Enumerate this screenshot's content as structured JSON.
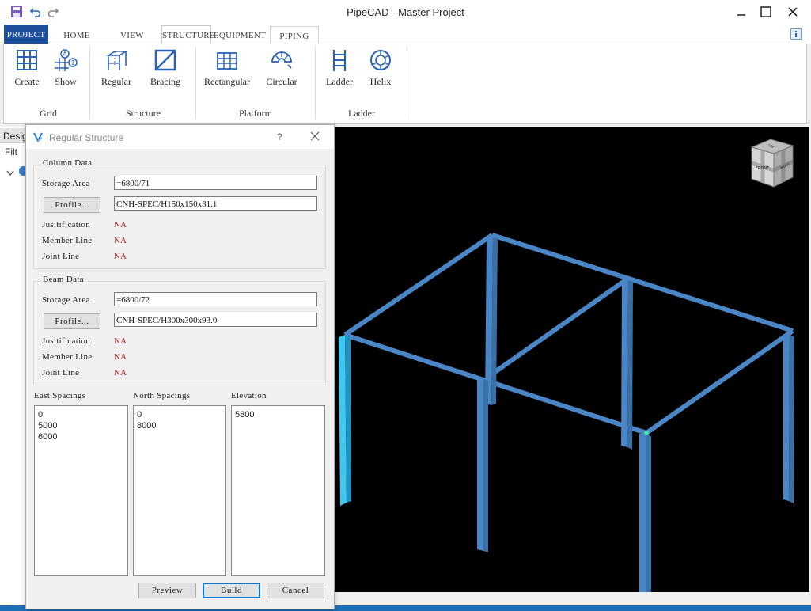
{
  "window": {
    "title": "PipeCAD - Master Project"
  },
  "icons": {
    "save": "save-icon",
    "undo": "undo-icon",
    "redo": "redo-icon",
    "minimize": "minimize-icon",
    "maximize": "maximize-icon",
    "close": "close-icon",
    "info": "info-icon"
  },
  "tabs": [
    {
      "label": "PROJECT"
    },
    {
      "label": "HOME"
    },
    {
      "label": "VIEW"
    },
    {
      "label": "STRUCTURE"
    },
    {
      "label": "EQUIPMENT"
    },
    {
      "label": "PIPING"
    }
  ],
  "ribbon": {
    "buttons": {
      "create": "Create",
      "show": "Show",
      "regular": "Regular",
      "bracing": "Bracing",
      "rectangular": "Rectangular",
      "circular": "Circular",
      "ladder": "Ladder",
      "helix": "Helix"
    },
    "groups": {
      "grid": "Grid",
      "structure": "Structure",
      "platform": "Platform",
      "ladder": "Ladder"
    }
  },
  "leftpanel": {
    "tab_label": "Desig",
    "filter_label": "Filt"
  },
  "dialog": {
    "title": "Regular Structure",
    "help": "?",
    "column": {
      "group_title": "Column Data",
      "storage_label": "Storage Area",
      "storage_value": "=6800/71",
      "profile_button": "Profile...",
      "profile_value": "CNH-SPEC/H150x150x31.1",
      "justification_label": "Jusitification",
      "justification_value": "NA",
      "member_label": "Member Line",
      "member_value": "NA",
      "joint_label": "Joint Line",
      "joint_value": "NA"
    },
    "beam": {
      "group_title": "Beam Data",
      "storage_label": "Storage Area",
      "storage_value": "=6800/72",
      "profile_button": "Profile...",
      "profile_value": "CNH-SPEC/H300x300x93.0",
      "justification_label": "Jusitification",
      "justification_value": "NA",
      "member_label": "Member Line",
      "member_value": "NA",
      "joint_label": "Joint Line",
      "joint_value": "NA"
    },
    "east": {
      "label": "East Spacings",
      "items": [
        "0",
        "5000",
        "6000"
      ]
    },
    "north": {
      "label": "North Spacings",
      "items": [
        "0",
        "8000"
      ]
    },
    "elevation": {
      "label": "Elevation",
      "items": [
        "5800"
      ]
    },
    "buttons": {
      "preview": "Preview",
      "build": "Build",
      "cancel": "Cancel"
    }
  },
  "viewcube": {
    "front": "FRONT",
    "top": "TOP",
    "right": "RIGHT"
  },
  "colors": {
    "accent": "#1e4f9c",
    "steel": "#4a86c5",
    "selected": "#3ec8f0",
    "na": "#b22020"
  }
}
